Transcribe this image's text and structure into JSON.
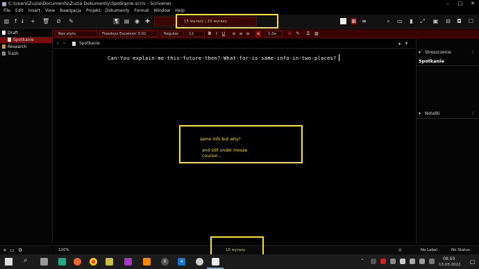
{
  "window": {
    "title": "C:\\Users\\Zuzia\\Documents\\Zuzia Dokumenty\\Spotkanie.scriv - Scrivener"
  },
  "menu": [
    "File",
    "Edit",
    "Insert",
    "View",
    "Nawigacja",
    "Projekt",
    "Dokumenty",
    "Format",
    "Window",
    "Help"
  ],
  "toolbar": {
    "word_count": "15 wyrazy | 15 wyrazy"
  },
  "format": {
    "style": "Bez stylu",
    "font": "Fixedsys Excelsior 3.01",
    "weight": "Regular",
    "size": "12",
    "spacing": "1.0x"
  },
  "binder": {
    "draft": "Draft",
    "doc": "Spotkanie",
    "research": "Research",
    "trash": "Trash"
  },
  "editor": {
    "doc_title": "Spotkanie",
    "text": "Can·You·explain·me·this·future·then?·What·for·is·same·info·in·two·places?",
    "zoom": "110%",
    "footer_count": "15 wyrazy",
    "label": "No Label",
    "status": "No Status"
  },
  "annotation": {
    "line1": "same info but why?",
    "line2": "and still under mouse",
    "line3": "coursor..."
  },
  "inspector": {
    "synopsis_label": "Streszczenie",
    "synopsis_title": "Spotkanie",
    "notes_label": "Notatki"
  },
  "taskbar": {
    "time": "08:50",
    "date": "13.03.2022",
    "badge1": "0",
    "badge2": "4"
  },
  "colors": {
    "accent": "#3a0303",
    "highlight": "#ffe11a",
    "selected": "#7a0a0a"
  }
}
